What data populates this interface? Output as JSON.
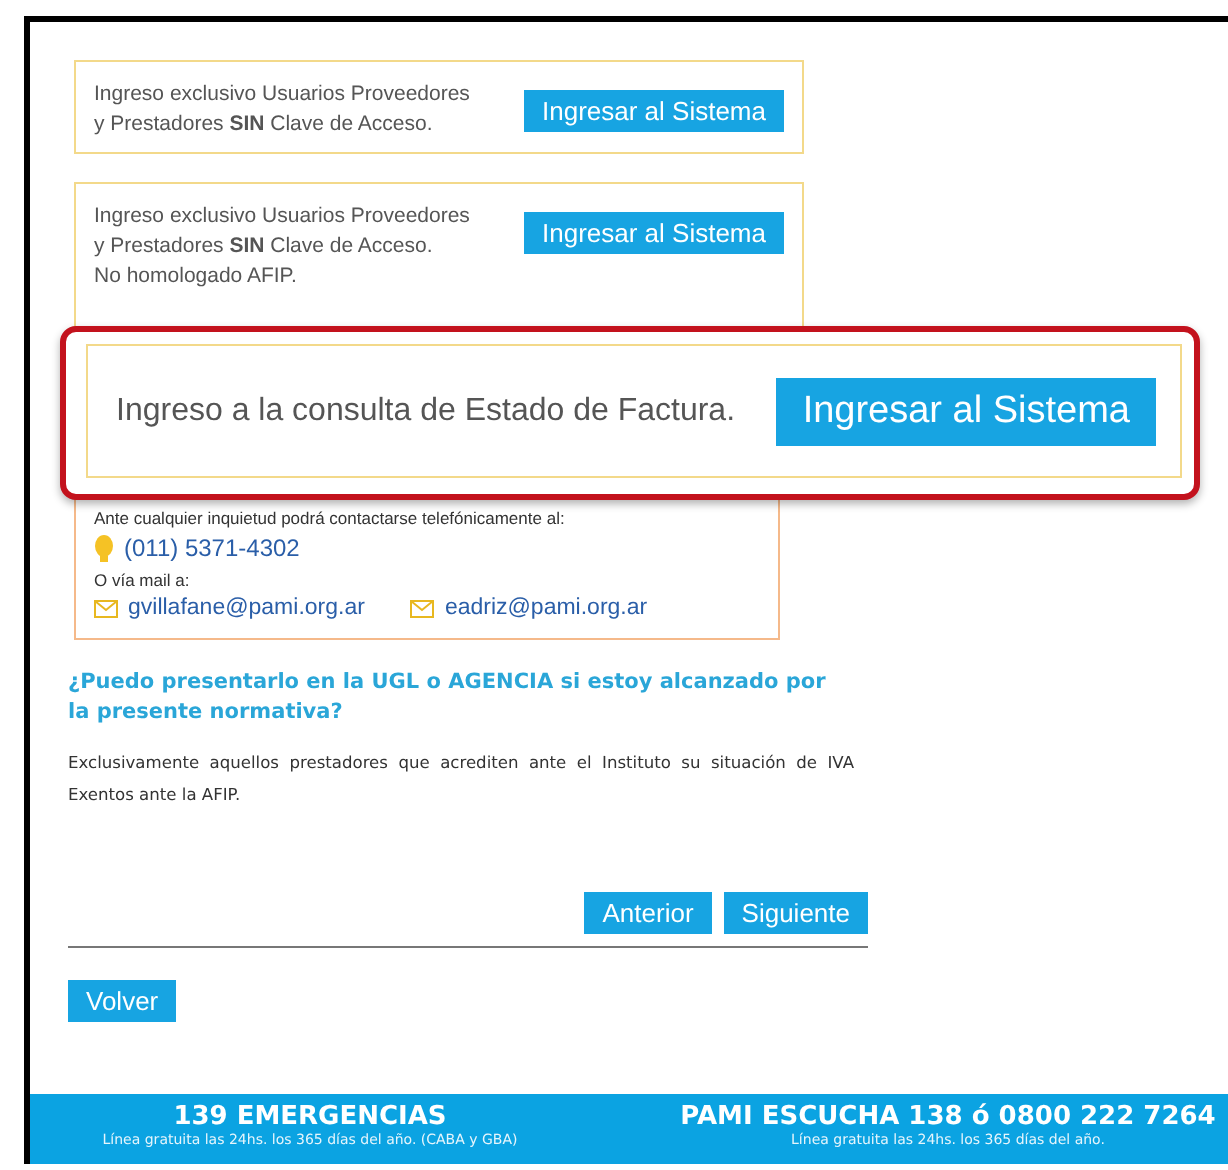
{
  "access_boxes": [
    {
      "lines": [
        "Ingreso exclusivo Usuarios Proveedores",
        "y Prestadores **SIN** Clave de Acceso."
      ],
      "button": "Ingresar al Sistema"
    },
    {
      "lines": [
        "Ingreso exclusivo Usuarios Proveedores",
        "y Prestadores **SIN** Clave de Acceso.",
        "No homologado AFIP."
      ],
      "button": "Ingresar al Sistema"
    }
  ],
  "highlight": {
    "text": "Ingreso a la consulta de Estado de Factura.",
    "button": "Ingresar al Sistema"
  },
  "contact": {
    "phone_intro": "Ante cualquier inquietud podrá contactarse telefónicamente al:",
    "phone": "(011) 5371-4302",
    "mail_intro": "O vía mail a:",
    "emails": [
      "gvillafane@pami.org.ar",
      "eadriz@pami.org.ar"
    ]
  },
  "faq": {
    "question": "¿Puedo presentarlo en la UGL o AGENCIA si estoy alcanzado por la presente normativa?",
    "answer": "Exclusivamente aquellos prestadores que acrediten ante el Instituto su situación de IVA Exentos ante la AFIP."
  },
  "nav_buttons": [
    "Anterior",
    "Siguiente"
  ],
  "back_button": "Volver",
  "footer": [
    {
      "title": "139 EMERGENCIAS",
      "subtitle": "Línea gratuita las 24hs. los 365 días del año. (CABA y GBA)"
    },
    {
      "title": "PAMI ESCUCHA 138 ó 0800 222 7264",
      "subtitle": "Línea gratuita las 24hs. los 365 días del año."
    }
  ]
}
